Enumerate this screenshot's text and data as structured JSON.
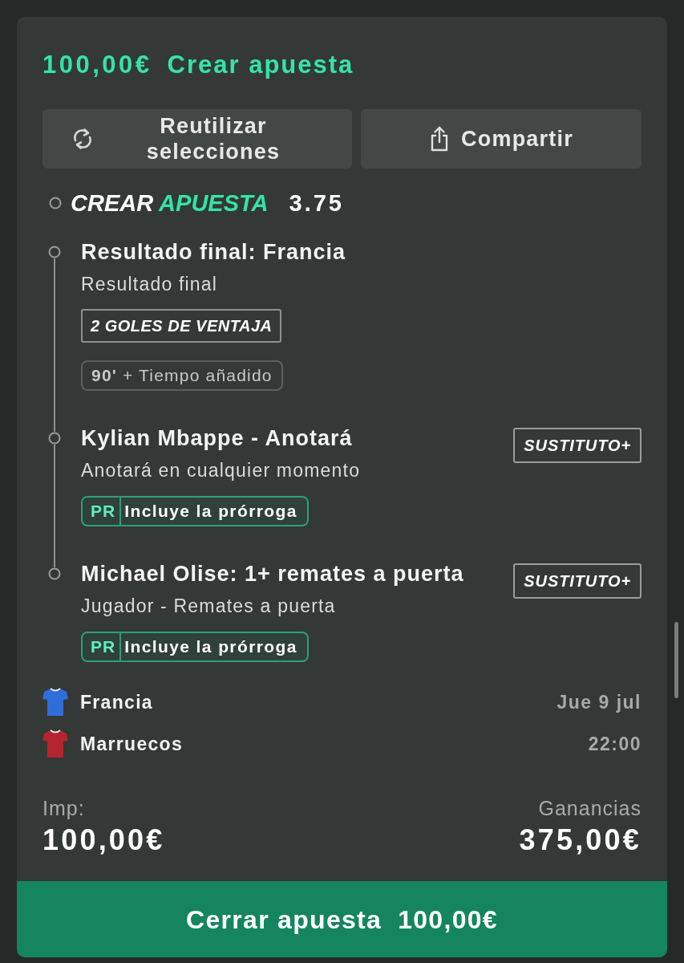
{
  "header": {
    "amount": "100,00€",
    "title": "Crear apuesta"
  },
  "actions": [
    {
      "kind": "reuse",
      "label": "Reutilizar selecciones"
    },
    {
      "kind": "share",
      "label": "Compartir"
    }
  ],
  "bet_builder": {
    "title": "CREAR",
    "title_highlight": "APUESTA",
    "odds": "3.75"
  },
  "selections": [
    {
      "title": "Resultado final: Francia",
      "market": "Resultado final",
      "tags": [
        {
          "kind": "outline",
          "text": "2 GOLES DE VENTAJA"
        },
        {
          "kind": "time",
          "text": "**90'** + Tiempo añadido"
        }
      ]
    },
    {
      "title": "Kylian Mbappe - Anotará",
      "market": "Anotará en cualquier momento",
      "badge": "SUSTITUTO+",
      "tags": [
        {
          "kind": "extra",
          "code": "PR",
          "text": "Incluye la prórroga"
        }
      ]
    },
    {
      "title": "Michael Olise: 1+ remates a puerta",
      "market": "Jugador - Remates a puerta",
      "badge": "SUSTITUTO+",
      "tags": [
        {
          "kind": "extra",
          "code": "PR",
          "text": "Incluye la prórroga"
        }
      ]
    }
  ],
  "match": {
    "teams": [
      {
        "name": "Francia",
        "color": "#2f6ed8"
      },
      {
        "name": "Marruecos",
        "color": "#b3242f"
      }
    ],
    "date": "Jue 9 jul",
    "time": "22:00"
  },
  "totals": {
    "stake_label": "Imp:",
    "stake": "100,00€",
    "returns_label": "Ganancias",
    "returns": "375,00€"
  },
  "place_button": {
    "label": "Cerrar apuesta",
    "amount": "100,00€"
  }
}
